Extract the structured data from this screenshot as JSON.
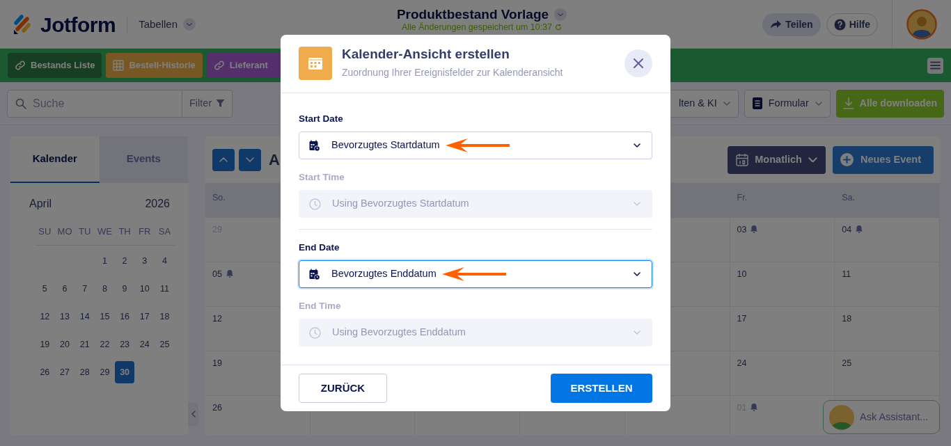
{
  "header": {
    "logo": "Jotform",
    "menu_label": "Tabellen",
    "title": "Produktbestand Vorlage",
    "save_status": "Alle Änderungen gespeichert um 10:37",
    "buttons": [
      {
        "label": "Teilen",
        "kind": "share"
      },
      {
        "label": "Hilfe",
        "kind": "help"
      }
    ]
  },
  "table_tabs": [
    {
      "label": "Bestands Liste",
      "kind": "link"
    },
    {
      "label": "Bestell-Historie",
      "kind": "table"
    },
    {
      "label": "Lieferant",
      "kind": "link"
    }
  ],
  "toolbar": {
    "search_placeholder": "Suche",
    "filter_label": "Filter",
    "buttons": [
      {
        "label": "lten & KI",
        "kind": "dropdown"
      },
      {
        "label": "Formular",
        "kind": "form"
      },
      {
        "label": "Alle downloaden",
        "kind": "download"
      }
    ]
  },
  "sidebar": {
    "tabs": [
      {
        "label": "Kalender",
        "selected": true
      },
      {
        "label": "Events",
        "selected": false
      }
    ],
    "month": "April",
    "year": "2026",
    "weekdays": [
      "SU",
      "MO",
      "TU",
      "WE",
      "TH",
      "FR",
      "SA"
    ],
    "weeks": [
      {
        "days": [
          {
            "label": "1",
            "selected": false
          },
          {
            "label": "2",
            "selected": false
          },
          {
            "label": "3",
            "selected": false
          },
          {
            "label": "4",
            "selected": false
          }
        ]
      },
      {
        "days": [
          {
            "label": "5",
            "selected": false
          },
          {
            "label": "6",
            "selected": false
          },
          {
            "label": "7",
            "selected": false
          },
          {
            "label": "8",
            "selected": false
          },
          {
            "label": "9",
            "selected": false
          },
          {
            "label": "10",
            "selected": false
          },
          {
            "label": "11",
            "selected": false
          }
        ]
      },
      {
        "days": [
          {
            "label": "12",
            "selected": false
          },
          {
            "label": "13",
            "selected": false
          },
          {
            "label": "14",
            "selected": false
          },
          {
            "label": "15",
            "selected": false
          },
          {
            "label": "16",
            "selected": false
          },
          {
            "label": "17",
            "selected": false
          },
          {
            "label": "18",
            "selected": false
          }
        ]
      },
      {
        "days": [
          {
            "label": "19",
            "selected": false
          },
          {
            "label": "20",
            "selected": false
          },
          {
            "label": "21",
            "selected": false
          },
          {
            "label": "22",
            "selected": false
          },
          {
            "label": "23",
            "selected": false
          },
          {
            "label": "24",
            "selected": false
          },
          {
            "label": "25",
            "selected": false
          }
        ]
      },
      {
        "days": [
          {
            "label": "26",
            "selected": false
          },
          {
            "label": "27",
            "selected": false
          },
          {
            "label": "28",
            "selected": false
          },
          {
            "label": "29",
            "selected": false
          },
          {
            "label": "30",
            "selected": true
          }
        ]
      }
    ]
  },
  "calendar": {
    "month_title": "A",
    "view_button": "Monatlich",
    "new_event_button": "Neues Event",
    "columns": [
      {
        "weekday": "So."
      },
      {
        "weekday": "Fr."
      },
      {
        "weekday": "Sa."
      }
    ],
    "weeks": [
      [
        {
          "day": "29",
          "muted": true,
          "bell": false
        },
        {
          "day": "03",
          "muted": false,
          "bell": true
        },
        {
          "day": "04",
          "muted": false,
          "bell": true
        }
      ],
      [
        {
          "day": "05",
          "muted": false,
          "bell": true
        },
        {
          "day": "10",
          "muted": false,
          "bell": false
        },
        {
          "day": "11",
          "muted": false,
          "bell": false
        }
      ],
      [
        {
          "day": "12",
          "muted": false,
          "bell": false
        },
        {
          "day": "17",
          "muted": false,
          "bell": false
        },
        {
          "day": "18",
          "muted": false,
          "bell": false
        }
      ],
      [
        {
          "day": "19",
          "muted": false,
          "bell": false
        },
        {
          "day": "24",
          "muted": false,
          "bell": false
        },
        {
          "day": "25",
          "muted": false,
          "bell": false
        }
      ],
      [
        {
          "day": "26",
          "muted": false,
          "bell": false
        },
        {
          "day": "01",
          "muted": true,
          "bell": true
        }
      ]
    ]
  },
  "assistant": {
    "label": "Ask Assistant..."
  },
  "modal": {
    "title": "Kalender-Ansicht erstellen",
    "subtitle": "Zuordnung Ihrer Ereignisfelder zur Kalenderansicht",
    "sections": [
      {
        "fields": [
          {
            "kind": "date",
            "label": "Start Date",
            "value": "Bevorzugtes Startdatum",
            "disabled": false,
            "focused": false,
            "pointer_arrow": true
          },
          {
            "kind": "time",
            "label": "Start Time",
            "value": "Using Bevorzugtes Startdatum",
            "disabled": true,
            "focused": false,
            "pointer_arrow": false
          }
        ]
      },
      {
        "fields": [
          {
            "kind": "date",
            "label": "End Date",
            "value": "Bevorzugtes Enddatum",
            "disabled": false,
            "focused": true,
            "pointer_arrow": true
          },
          {
            "kind": "time",
            "label": "End Time",
            "value": "Using Bevorzugtes Enddatum",
            "disabled": true,
            "focused": false,
            "pointer_arrow": false
          }
        ]
      }
    ],
    "buttons": [
      {
        "label": "ZURÜCK",
        "kind": "secondary"
      },
      {
        "label": "ERSTELLEN",
        "kind": "primary"
      }
    ]
  }
}
